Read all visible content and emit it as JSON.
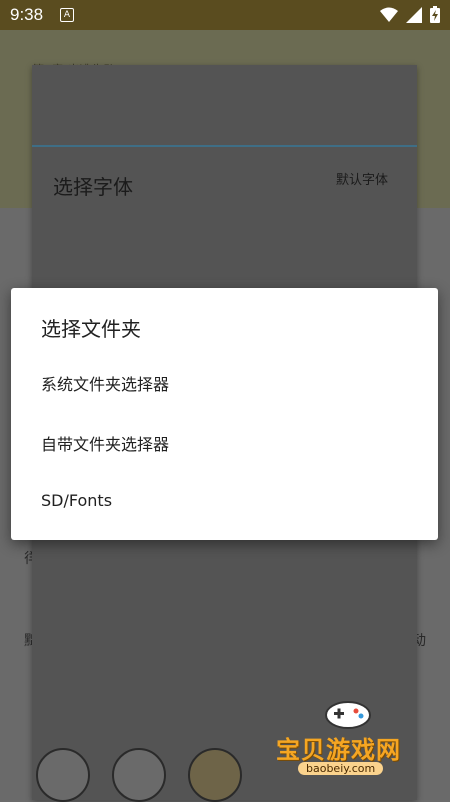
{
  "status_bar": {
    "time": "9:38",
    "notification_glyph": "A",
    "icons": [
      "wifi-icon",
      "signal-icon",
      "battery-charging-icon"
    ]
  },
  "background": {
    "chapter_title": "第1章 出逃失败",
    "left_char": "徉",
    "left_char2": "黜",
    "right_char": "动"
  },
  "font_panel": {
    "title": "选择字体",
    "default_font": "默认字体"
  },
  "dialog": {
    "title": "选择文件夹",
    "options": [
      {
        "label": "系统文件夹选择器"
      },
      {
        "label": "自带文件夹选择器"
      },
      {
        "label": "SD/Fonts"
      }
    ]
  },
  "watermark": {
    "text": "宝贝游戏网",
    "url": "baobeiy.com"
  },
  "colors": {
    "status_bar": "#5a4c1f",
    "accent_line": "#3e6e86",
    "dialog_bg": "#ffffff",
    "watermark": "#f5a623"
  }
}
